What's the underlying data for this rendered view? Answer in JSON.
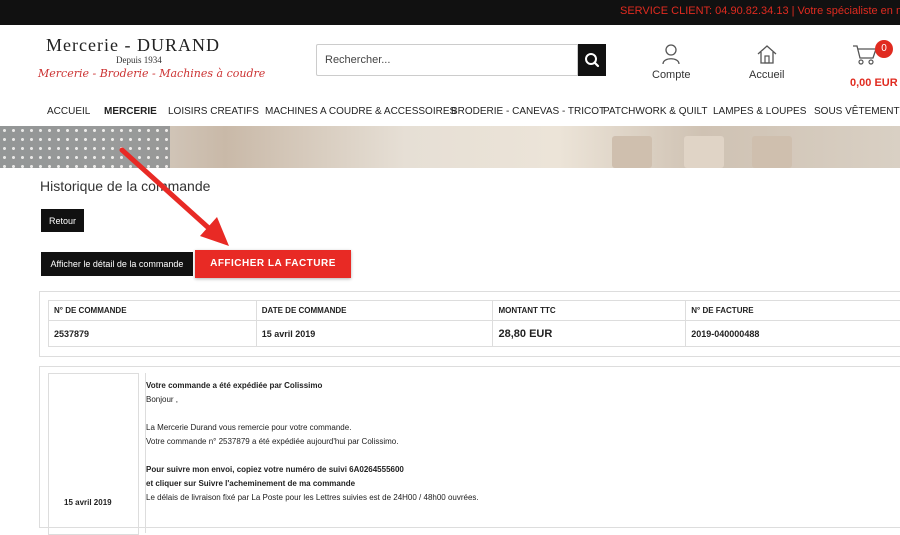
{
  "topbar": {
    "text": "SERVICE CLIENT: 04.90.82.34.13 | Votre spécialiste en mercerie"
  },
  "logo": {
    "name": "Mercerie - DURAND",
    "since": "Depuis 1934",
    "tagline": "Mercerie - Broderie - Machines à coudre"
  },
  "search": {
    "placeholder": "Rechercher...",
    "icon": "search-icon"
  },
  "header_links": {
    "account": "Compte",
    "home": "Accueil"
  },
  "cart": {
    "count": "0",
    "total": "0,00 EUR"
  },
  "nav": [
    "ACCUEIL",
    "MERCERIE",
    "LOISIRS CREATIFS",
    "MACHINES A COUDRE & ACCESSOIRES",
    "BRODERIE - CANEVAS - TRICOT",
    "PATCHWORK & QUILT",
    "LAMPES & LOUPES",
    "SOUS VÊTEMENTS -"
  ],
  "nav_active": "MERCERIE",
  "page": {
    "title": "Historique de la commande",
    "back_button": "Retour",
    "detail_button": "Afficher le détail de la commande",
    "invoice_button": "AFFICHER LA FACTURE"
  },
  "order_table": {
    "headers": [
      "N° DE COMMANDE",
      "DATE DE COMMANDE",
      "MONTANT TTC",
      "N° DE FACTURE"
    ],
    "row": [
      "2537879",
      "15 avril 2019",
      "28,80 EUR",
      "2019-040000488"
    ]
  },
  "message": {
    "date": "15 avril 2019",
    "lines": [
      "Votre commande a été expédiée par Colissimo",
      "Bonjour ,",
      "",
      "La Mercerie Durand vous remercie pour votre commande.",
      "Votre commande n° 2537879  a été expédiée aujourd'hui par Colissimo.",
      "",
      "Pour suivre mon envoi, copiez votre numéro de suivi 6A0264555600",
      "et cliquer sur Suivre l'acheminement de ma commande",
      "Le délais de livraison fixé par La Poste pour les Lettres suivies est de 24H00 / 48h00 ouvrées."
    ]
  },
  "colors": {
    "accent": "#e82a25",
    "dark": "#111111"
  }
}
